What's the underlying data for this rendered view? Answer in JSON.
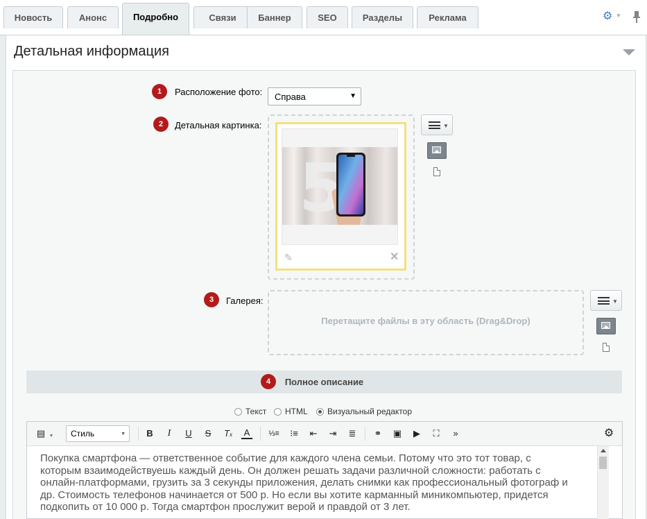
{
  "tabs": [
    {
      "label": "Новость",
      "active": false
    },
    {
      "label": "Анонс",
      "active": false
    },
    {
      "label": "Подробно",
      "active": true
    },
    {
      "label": "Связи",
      "active": false
    },
    {
      "label": "Баннер",
      "active": false
    },
    {
      "label": "SEO",
      "active": false
    },
    {
      "label": "Разделы",
      "active": false
    },
    {
      "label": "Реклама",
      "active": false
    }
  ],
  "icons": {
    "settings": "gear-icon",
    "pin": "pin-icon",
    "accent_color": "#3b7fc4"
  },
  "section": {
    "title": "Детальная информация"
  },
  "fields": {
    "photo_position": {
      "badge": "1",
      "label": "Расположение фото:",
      "value": "Справа"
    },
    "detail_picture": {
      "badge": "2",
      "label": "Детальная картинка:"
    },
    "gallery": {
      "badge": "3",
      "label": "Галерея:",
      "hint": "Перетащите файлы в эту область (Drag&Drop)"
    }
  },
  "full_description": {
    "badge": "4",
    "title": "Полное описание",
    "modes": [
      {
        "label": "Текст",
        "selected": false
      },
      {
        "label": "HTML",
        "selected": false
      },
      {
        "label": "Визуальный редактор",
        "selected": true
      }
    ],
    "style_select": "Стиль",
    "content_lines": [
      "Покупка смартфона — ответственное событие для каждого члена семьи. Потому что это тот товар, с",
      "которым взаимодействуешь каждый день. Он должен решать задачи различной сложности: работать с",
      "онлайн-платформами, грузить за 3 секунды приложения, делать снимки как профессиональный фотограф и",
      "др. Стоимость телефонов начинается от 500 р. Но если вы хотите карманный миникомпьютер, придется",
      "подкопить от 10 000 р. Тогда смартфон прослужит верой и правдой от 3 лет."
    ]
  },
  "colors": {
    "badge": "#b31b1b",
    "frame_highlight": "#f3e17b",
    "panel_bg": "#e8edee"
  }
}
